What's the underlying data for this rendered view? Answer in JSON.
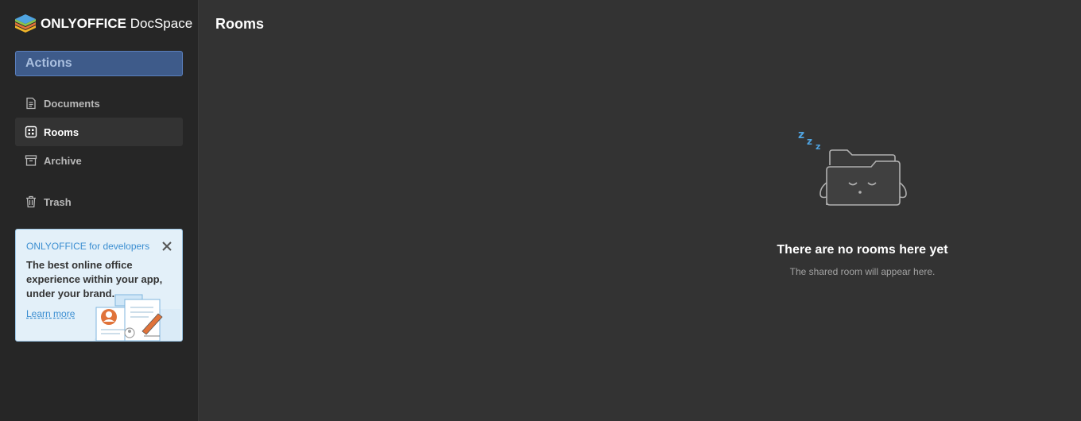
{
  "brand": {
    "name_bold": "ONLYOFFICE",
    "name_light": " DocSpace"
  },
  "sidebar": {
    "actions_label": "Actions",
    "items": [
      {
        "label": "Documents",
        "icon": "document-icon",
        "active": false
      },
      {
        "label": "Rooms",
        "icon": "rooms-icon",
        "active": true
      },
      {
        "label": "Archive",
        "icon": "archive-icon",
        "active": false
      },
      {
        "label": "Trash",
        "icon": "trash-icon",
        "active": false
      }
    ]
  },
  "promo": {
    "title": "ONLYOFFICE for developers",
    "text": "The best online office experience within your app, under your brand.",
    "link": "Learn more"
  },
  "main": {
    "title": "Rooms",
    "empty_title": "There are no rooms here yet",
    "empty_subtitle": "The shared room will appear here.",
    "zzz": "Z Z Z"
  },
  "colors": {
    "accent": "#3e5b8a",
    "link": "#3b8ed1",
    "background": "#333333",
    "sidebar": "#262626"
  }
}
